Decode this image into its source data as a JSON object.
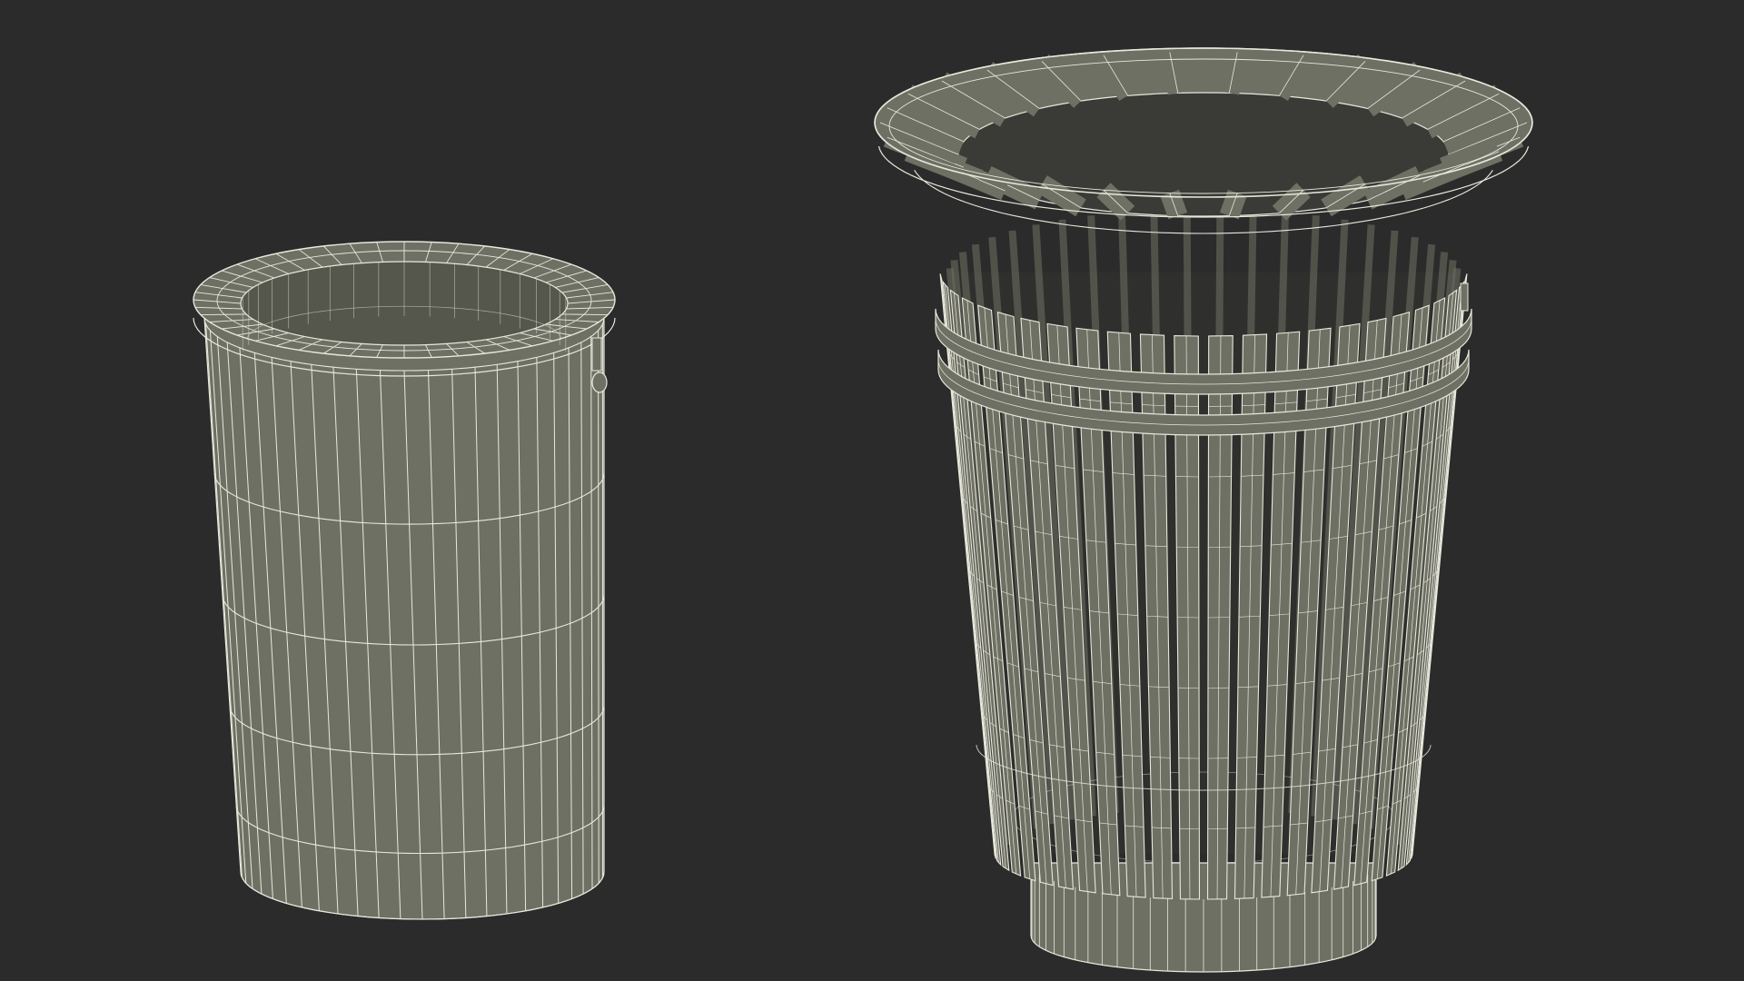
{
  "scene": {
    "background_color": "#2a2b2a",
    "mesh_fill_color": "#6f7064",
    "mesh_fill_dark": "#55564c",
    "wire_color": "#e8e8dc",
    "objects": [
      {
        "name": "solid-cylinder-bin"
      },
      {
        "name": "slatted-flared-bin"
      }
    ]
  }
}
